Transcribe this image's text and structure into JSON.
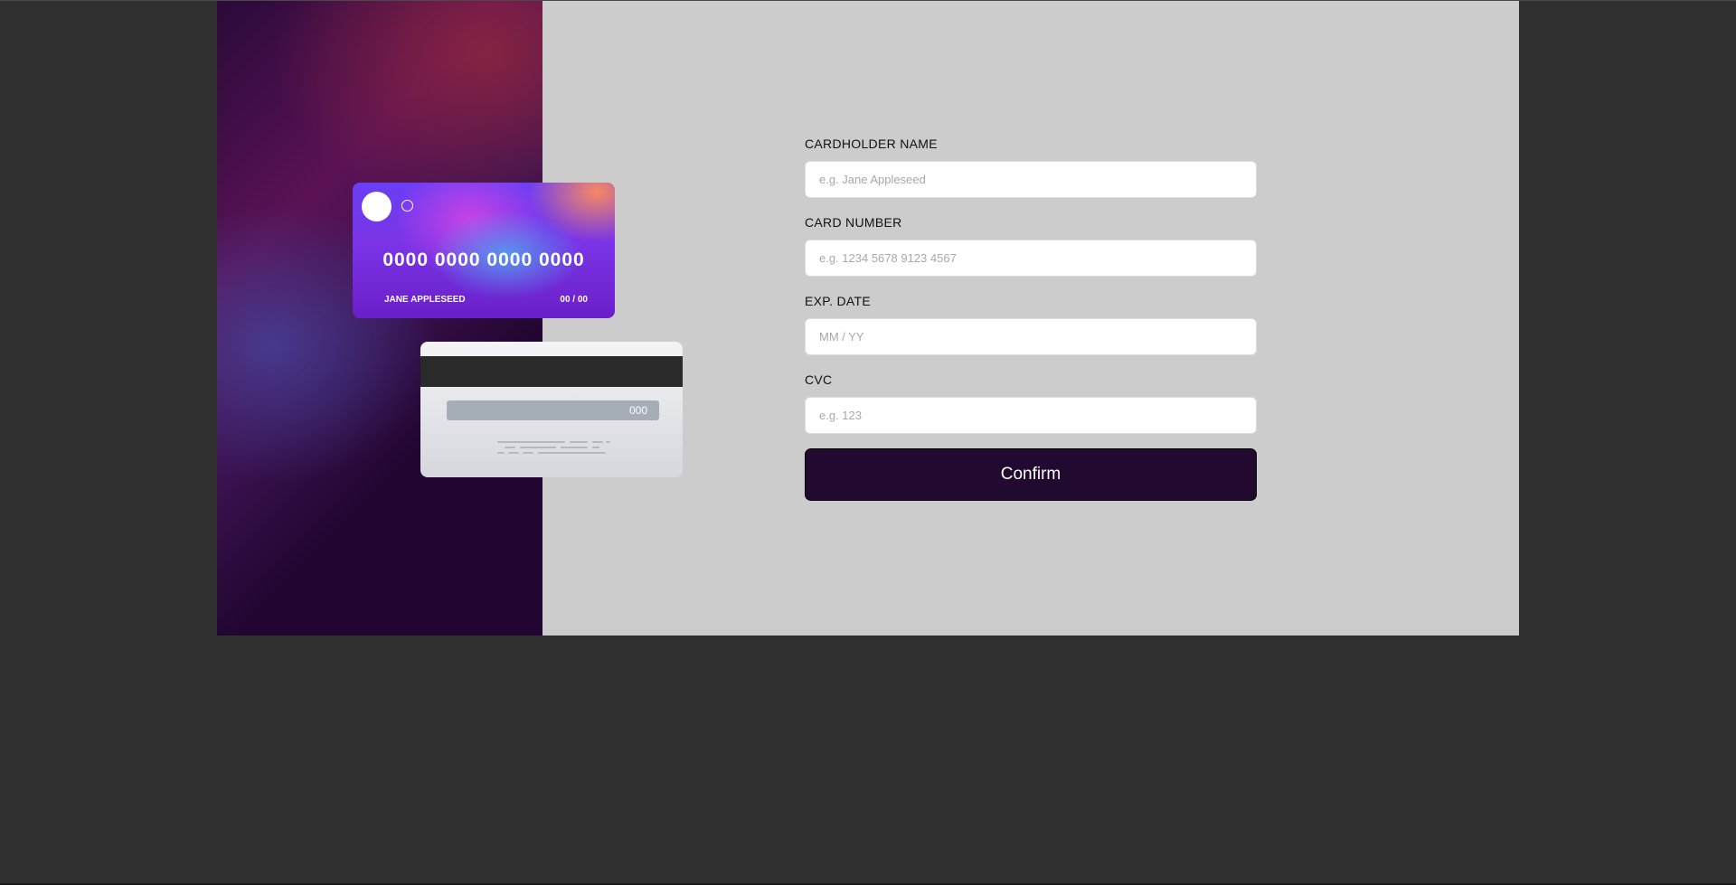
{
  "card_front": {
    "number": "0000 0000 0000 0000",
    "name": "JANE APPLESEED",
    "expiry": "00 / 00"
  },
  "card_back": {
    "cvc": "000"
  },
  "form": {
    "cardholder_name": {
      "label": "CARDHOLDER NAME",
      "placeholder": "e.g. Jane Appleseed",
      "value": ""
    },
    "card_number": {
      "label": "CARD NUMBER",
      "placeholder": "e.g. 1234 5678 9123 4567",
      "value": ""
    },
    "exp_date": {
      "label": "EXP. DATE",
      "placeholder": "MM / YY",
      "value": ""
    },
    "cvc": {
      "label": "CVC",
      "placeholder": "e.g. 123",
      "value": ""
    },
    "confirm_label": "Confirm"
  },
  "colors": {
    "page_background": "#303030",
    "panel_background": "#cccccc",
    "button_background": "#21092f",
    "button_text": "#ffffff"
  }
}
